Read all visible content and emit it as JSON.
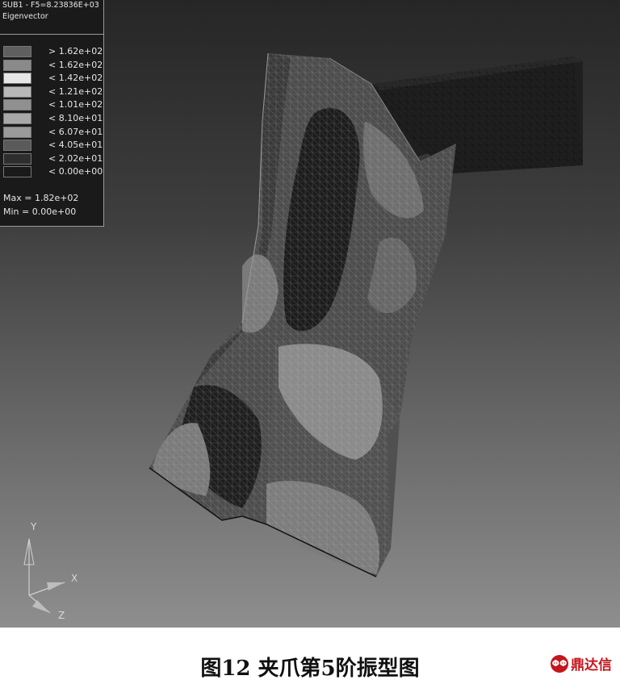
{
  "legend": {
    "title": "SUB1 - F5=8.23836E+03",
    "subtitle": "Eigenvector",
    "items": [
      {
        "label": "> 1.62e+02",
        "color": "#5f5f5f"
      },
      {
        "label": "< 1.62e+02",
        "color": "#8a8a8a"
      },
      {
        "label": "< 1.42e+02",
        "color": "#e6e6e6"
      },
      {
        "label": "< 1.21e+02",
        "color": "#b8b8b8"
      },
      {
        "label": "< 1.01e+02",
        "color": "#909090"
      },
      {
        "label": "< 8.10e+01",
        "color": "#a8a8a8"
      },
      {
        "label": "< 6.07e+01",
        "color": "#9a9a9a"
      },
      {
        "label": "< 4.05e+01",
        "color": "#5a5a5a"
      },
      {
        "label": "< 2.02e+01",
        "color": "#2e2e2e"
      },
      {
        "label": "< 0.00e+00",
        "color": "#1a1a1a"
      }
    ],
    "max": "Max = 1.82e+02",
    "min": "Min = 0.00e+00"
  },
  "axes": {
    "y": "Y",
    "x": "X",
    "z": "Z"
  },
  "caption": "图12  夹爪第5阶振型图",
  "watermark": {
    "logo": "ΦΦ",
    "text": "鼎达信"
  }
}
